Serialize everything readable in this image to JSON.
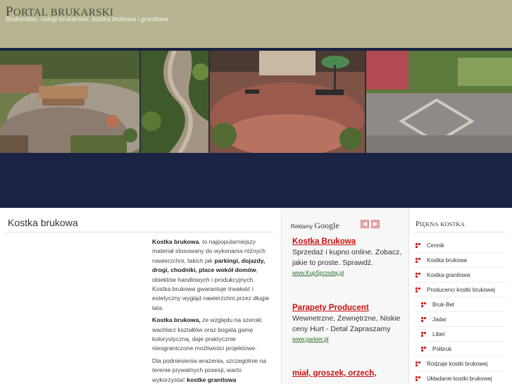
{
  "header": {
    "title_first": "P",
    "title_rest": "ORTAL BRUKARSKI",
    "subtitle": "Brukarstwo, usługi brukarskie, kostka brukowa i granitowa"
  },
  "main": {
    "title": "Kostka brukowa",
    "p1_b1": "Kostka brukowa",
    "p1_t1": ", to najpopularniejszy materiał stosowany do wykonania różnych nawierzchni, takich jak ",
    "p1_b2": "parkingi, dojazdy, drogi, chodniki, place wokół domów",
    "p1_t2": ", obiektów handlowych i produkcyjnych. Kostka brukowa gwarantuje trwałość i estetyczny wygląd nawierzchni przez długie lata.",
    "p2_b1": "Kostka brukowa,",
    "p2_t1": " ze względu na szeroki wachlarz kształtów oraz bogatą gamę kolorystyczną, daje praktycznie nieograniczone możliwości projektowe.",
    "p3_t1": "Dla podniesienia wrażenia, szczególnie na terenie prywatnych posesji, warto wykorzystać ",
    "p3_b1": "kostke granitowa"
  },
  "ads": {
    "label": "Reklamy",
    "brand": "Google",
    "prev": "◀",
    "next": "▶",
    "items": [
      {
        "title": "Kostka Brukowa",
        "text": "Sprzedaż i kupno online. Zobacz, jakie to proste. Sprawdź.",
        "url": "www.KupSprzedaj.pl"
      },
      {
        "title": "Parapety Producent",
        "text": "Wewnetrzne, Zewnętrzne, Niskie ceny Hurt - Detal Zapraszamy",
        "url": "www.parkier.pl"
      },
      {
        "title": "miał, groszek, orzech,",
        "text": "",
        "url": ""
      }
    ]
  },
  "sidebar": {
    "title_first": "P",
    "title_rest_1": "IĘKNA",
    "title_rest_2": "KOSTKA",
    "items": [
      {
        "label": "Cennik"
      },
      {
        "label": "Kostka brukowa"
      },
      {
        "label": "Kostka granitowa"
      },
      {
        "label": "Producenci kostki brukowej"
      },
      {
        "label": "Bruk-Bet"
      },
      {
        "label": "Jadar"
      },
      {
        "label": "Libet"
      },
      {
        "label": "Polbruk"
      },
      {
        "label": "Rodzaje kostki brukowej"
      },
      {
        "label": "Układanie kostki brukowej"
      }
    ]
  },
  "colors": {
    "header_bg": "#b6b492",
    "band": "#1b2344",
    "ad_title": "#cc1111",
    "bullet": "#dd2222"
  }
}
